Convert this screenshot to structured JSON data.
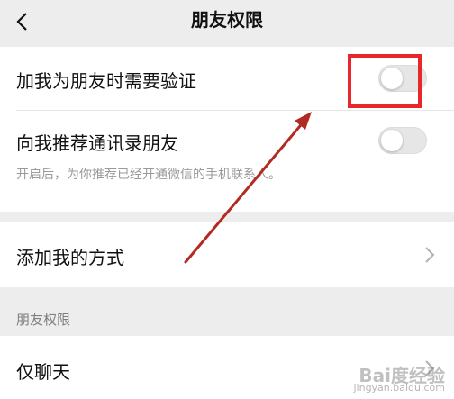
{
  "header": {
    "title": "朋友权限",
    "back_icon": "chevron-left-icon"
  },
  "settings": {
    "verify_label": "加我为朋友时需要验证",
    "verify_on": false,
    "recommend_label": "向我推荐通讯录朋友",
    "recommend_on": false,
    "recommend_hint": "开启后，为你推荐已经开通微信的手机联系人。",
    "add_methods_label": "添加我的方式"
  },
  "friend_permissions": {
    "section_title": "朋友权限",
    "chat_only_label": "仅聊天"
  },
  "colors": {
    "highlight": "#e8262b",
    "arrow": "#b22a24"
  },
  "watermark": {
    "brand": "Bai度经验",
    "url": "jingyan.baidu.com"
  }
}
